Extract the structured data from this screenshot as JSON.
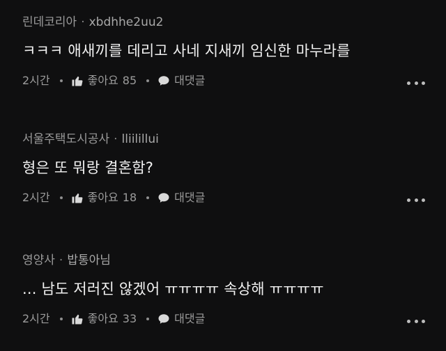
{
  "comments": [
    {
      "author": "린데코리아",
      "handle": "xbdhhe2uu2",
      "text": "ㅋㅋㅋ 애새끼를 데리고 사네  지새끼 임신한 마누라를",
      "time": "2시간",
      "like_label": "좋아요",
      "like_count": "85",
      "reply_label": "대댓글"
    },
    {
      "author": "서울주택도시공사",
      "handle": "lliilillui",
      "text": "형은 또 뭐랑 결혼함?",
      "time": "2시간",
      "like_label": "좋아요",
      "like_count": "18",
      "reply_label": "대댓글"
    },
    {
      "author": "영양사",
      "handle": "밥통아님",
      "text": "... 남도 저러진 않겠어 ㅠㅠㅠㅠ 속상해 ㅠㅠㅠㅠ",
      "time": "2시간",
      "like_label": "좋아요",
      "like_count": "33",
      "reply_label": "대댓글"
    }
  ],
  "icons": {
    "like": "thumbs-up-icon",
    "reply": "speech-bubble-icon",
    "more": "more-dots-icon"
  },
  "colors": {
    "background": "#0f0f10",
    "text": "#f2f2f2",
    "meta": "#9a9a9a"
  }
}
